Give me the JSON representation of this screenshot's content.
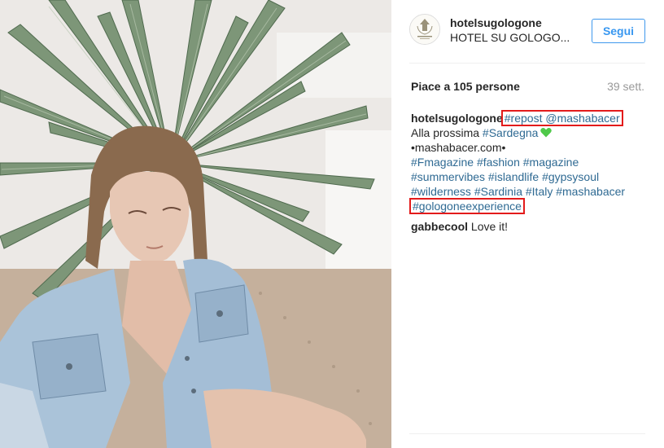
{
  "post": {
    "username": "hotelsugologone",
    "location": "HOTEL SU GOLOGO...",
    "follow_label": "Segui",
    "likes": "Piace a 105 persone",
    "time_ago": "39 sett."
  },
  "caption": {
    "author": "hotelsugologone",
    "repost_tag": "#repost",
    "repost_mention": "@mashabacer",
    "line2_text": "Alla prossima ",
    "line2_tag": "#Sardegna",
    "line3": "•mashabacer.com•",
    "line4": [
      "#Fmagazine",
      "#fashion",
      "#magazine"
    ],
    "line5": [
      "#summervibes",
      "#islandlife",
      "#gypsysoul"
    ],
    "line6": [
      "#wilderness",
      "#Sardinia",
      "#Italy",
      "#mashabacer"
    ],
    "line7": "#gologoneexperience"
  },
  "comment": {
    "author": "gabbecool",
    "text": "Love it!"
  },
  "colors": {
    "tag": "#2f6a93",
    "follow": "#3897f0",
    "highlight_box": "#e31b1b",
    "heart": "#4fc94a"
  }
}
